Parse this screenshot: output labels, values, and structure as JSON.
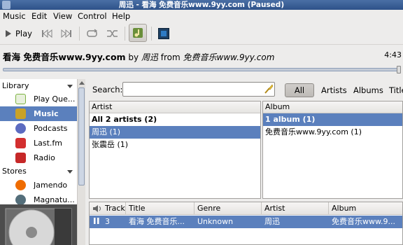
{
  "window": {
    "title": "周迅 - 看海  免费音乐www.9yy.com (Paused)"
  },
  "menu": [
    "Music",
    "Edit",
    "View",
    "Control",
    "Help"
  ],
  "toolbar": {
    "play_label": "Play"
  },
  "now_playing": {
    "title": "看海  免费音乐www.9yy.com",
    "by": "by",
    "artist": "周迅",
    "from": "from",
    "album": "免费音乐www.9yy.com",
    "time": "4:43",
    "progress": 1.0
  },
  "sidebar": {
    "library_header": "Library",
    "stores_header": "Stores",
    "library_items": [
      {
        "label": "Play Que...",
        "icon": "play-queue-icon",
        "color": "#7cb342"
      },
      {
        "label": "Music",
        "icon": "music-note-icon",
        "color": "#c9a227",
        "selected": true
      },
      {
        "label": "Podcasts",
        "icon": "podcast-icon",
        "color": "#5c6bc0"
      },
      {
        "label": "Last.fm",
        "icon": "lastfm-icon",
        "color": "#d32f2f"
      },
      {
        "label": "Radio",
        "icon": "radio-icon",
        "color": "#c62828"
      }
    ],
    "store_items": [
      {
        "label": "Jamendo",
        "icon": "jamendo-icon",
        "color": "#ef6c00"
      },
      {
        "label": "Magnatu...",
        "icon": "magnatune-icon",
        "color": "#546e7a"
      }
    ]
  },
  "search": {
    "label": "Search:",
    "value": "",
    "filters": [
      "All",
      "Artists",
      "Albums",
      "Title"
    ]
  },
  "artist_pane": {
    "header": "Artist",
    "rows": [
      {
        "label": "All 2 artists (2)",
        "bold": true,
        "selected": false
      },
      {
        "label": "周迅 (1)",
        "bold": false,
        "selected": true
      },
      {
        "label": "张震岳 (1)",
        "bold": false,
        "selected": false
      }
    ]
  },
  "album_pane": {
    "header": "Album",
    "rows": [
      {
        "label": "1 album (1)",
        "bold": true,
        "selected": true
      },
      {
        "label": "免费音乐www.9yy.com (1)",
        "bold": false,
        "selected": false
      }
    ]
  },
  "tracklist": {
    "columns": [
      "Track",
      "Title",
      "Genre",
      "Artist",
      "Album"
    ],
    "rows": [
      {
        "status": "pause-icon",
        "track": "3",
        "title": "看海  免费音乐...",
        "genre": "Unknown",
        "artist": "周迅",
        "album": "免费音乐www.9..."
      }
    ]
  },
  "colors": {
    "selection": "#5b80bd",
    "titlebar": "#3a5f97"
  }
}
